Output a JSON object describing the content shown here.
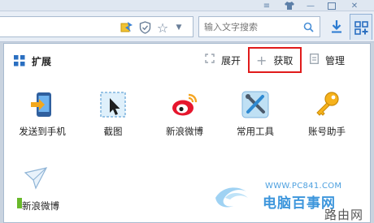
{
  "toolbar": {
    "search_placeholder": "输入文字搜索"
  },
  "panel": {
    "title": "扩展",
    "expand_label": "展开",
    "get_label": "获取",
    "manage_label": "管理"
  },
  "apps": [
    {
      "label": "发送到手机",
      "icon": "send-to-phone-icon"
    },
    {
      "label": "截图",
      "icon": "screenshot-icon"
    },
    {
      "label": "新浪微博",
      "icon": "weibo-icon"
    },
    {
      "label": "常用工具",
      "icon": "tools-icon"
    },
    {
      "label": "账号助手",
      "icon": "key-icon"
    },
    {
      "label": "新浪微博",
      "icon": "paper-plane-icon"
    }
  ],
  "watermark": {
    "url": "WWW.PC841.COM",
    "name": "电脑百事网",
    "luyou": "路由网"
  },
  "colors": {
    "highlight_border": "#e01b1b",
    "accent_blue": "#3d96dc"
  }
}
